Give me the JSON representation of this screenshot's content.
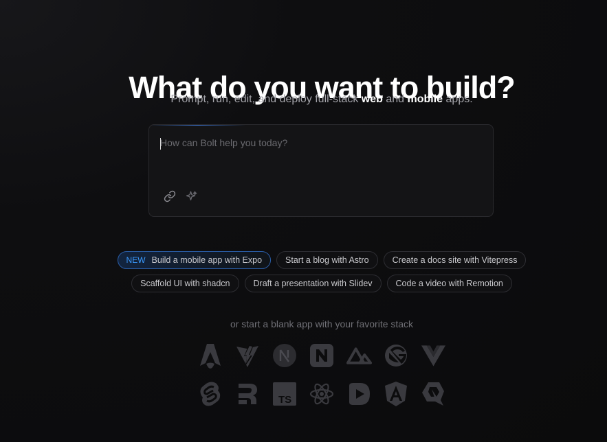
{
  "hero": {
    "title": "What do you want to build?",
    "subtitle_prefix": "Prompt, run, edit, and deploy full-stack ",
    "subtitle_web": "web",
    "subtitle_and": " and ",
    "subtitle_mobile": "mobile",
    "subtitle_suffix": " apps."
  },
  "prompt": {
    "placeholder": "How can Bolt help you today?",
    "value": "",
    "tools": [
      "link-icon",
      "sparkle-icon"
    ]
  },
  "suggestions": {
    "row1": [
      {
        "badge": "NEW",
        "label": "Build a mobile app with Expo"
      },
      {
        "label": "Start a blog with Astro"
      },
      {
        "label": "Create a docs site with Vitepress"
      }
    ],
    "row2": [
      {
        "label": "Scaffold UI with shadcn"
      },
      {
        "label": "Draft a presentation with Slidev"
      },
      {
        "label": "Code a video with Remotion"
      }
    ]
  },
  "blank_app": {
    "text": "or start a blank app with your favorite stack"
  },
  "stacks": {
    "row1": [
      "astro-icon",
      "vite-icon",
      "nextjs-icon",
      "nuxt-ui-icon",
      "nuxt-icon",
      "gatsby-icon",
      "vue-icon"
    ],
    "row2": [
      "svelte-icon",
      "remix-icon",
      "typescript-icon",
      "react-icon",
      "slidev-icon",
      "angular-icon",
      "qwik-icon"
    ]
  },
  "colors": {
    "background": "#0c0c0d",
    "accent": "#3b9bff",
    "icon": "#3a3a3f"
  }
}
